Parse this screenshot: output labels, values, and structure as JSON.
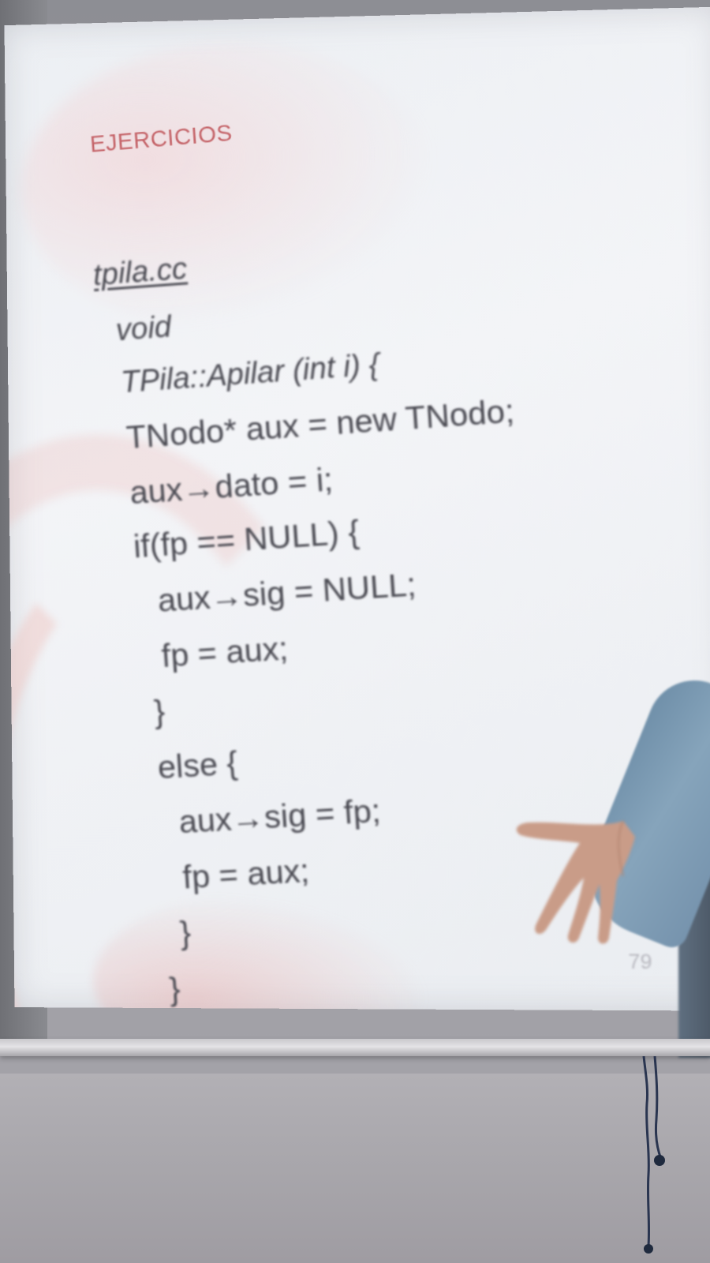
{
  "slide": {
    "title": "EJERCICIOS",
    "file_name": "tpila.cc",
    "code_lines": [
      "void",
      "TPila::Apilar (int i) {",
      "TNodo* aux = new TNodo;",
      "aux→dato = i;",
      "if(fp == NULL) {",
      "aux→sig = NULL;",
      "fp = aux;",
      "}",
      "else {",
      "aux→sig = fp;",
      "fp = aux;",
      "}",
      "}"
    ],
    "page_number": "79"
  },
  "colors": {
    "title": "#c5656a",
    "code_text": "#4a4a52",
    "slide_background": "#eef0f4",
    "swirl_accent": "#ecb0ac",
    "presenter_shirt": "#7c9ab3"
  }
}
